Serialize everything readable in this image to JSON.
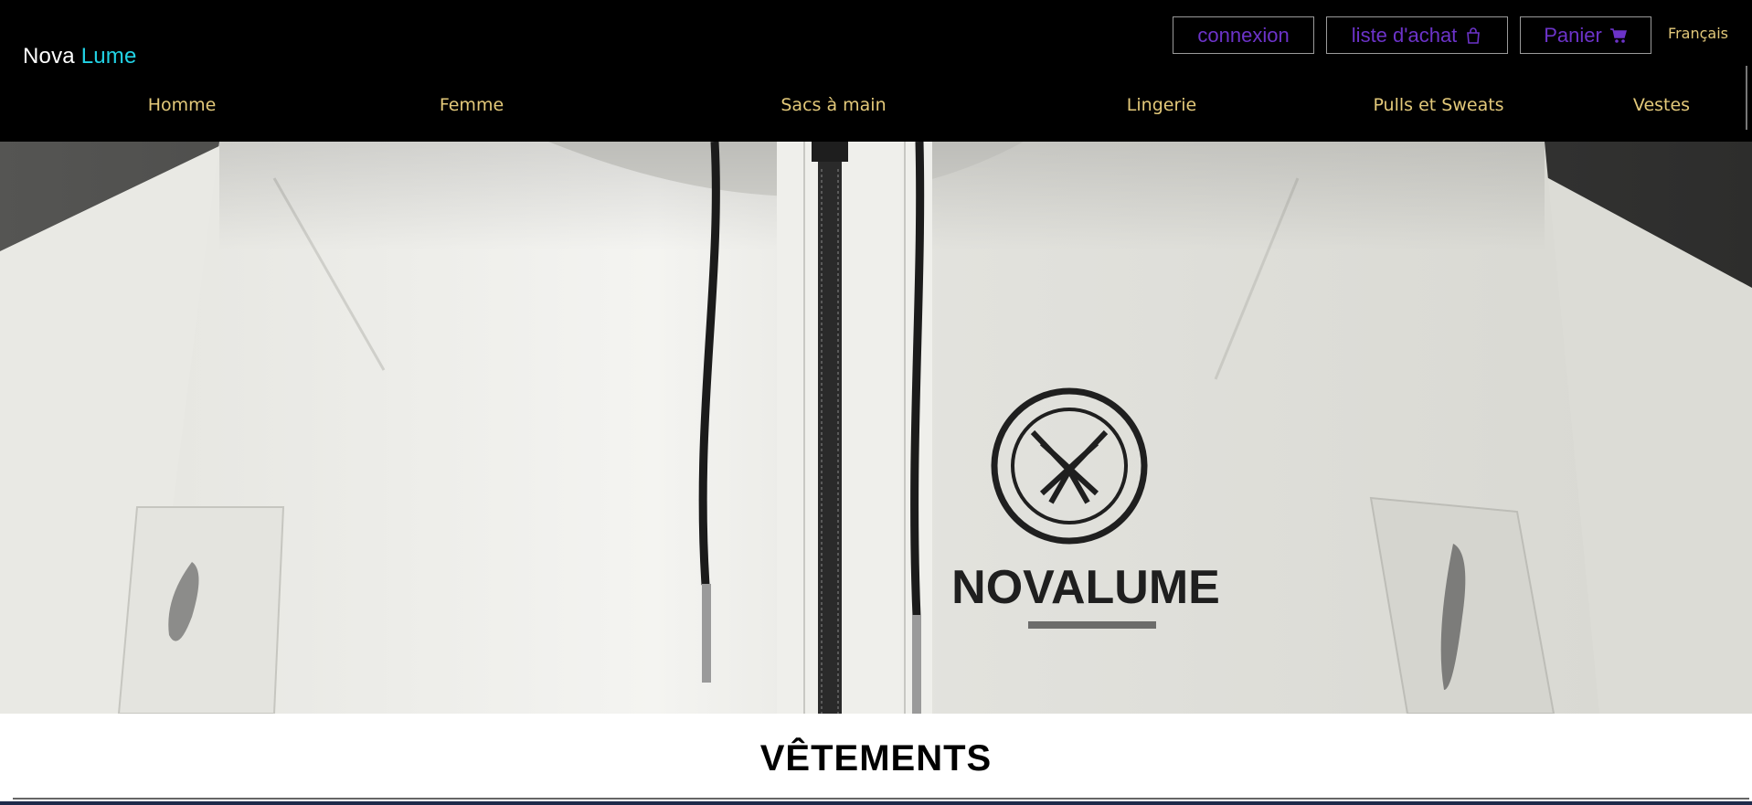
{
  "header": {
    "brand": {
      "word1": "Nova",
      "word2": "Lume"
    },
    "actions": {
      "login_label": "connexion",
      "wishlist_label": "liste d'achat",
      "cart_label": "Panier",
      "language": "Français"
    },
    "nav": [
      {
        "label": "Homme"
      },
      {
        "label": "Femme"
      },
      {
        "label": "Sacs à main"
      },
      {
        "label": "Lingerie"
      },
      {
        "label": "Pulls et Sweats"
      },
      {
        "label": "Vestes"
      }
    ]
  },
  "hero": {
    "logo_text": "NOVALUME",
    "colors": {
      "background": "#4a4a4a",
      "garment": "#eeeeea",
      "zipper": "#2a2a2a"
    }
  },
  "main": {
    "section_title": "VÊTEMENTS"
  },
  "colors": {
    "header_bg": "#000000",
    "brand_accent": "#22d3e6",
    "button_text": "#6c33c9",
    "nav_text": "#e3c97a"
  },
  "icons": {
    "wishlist": "shopping-bag-icon",
    "cart": "cart-icon"
  }
}
